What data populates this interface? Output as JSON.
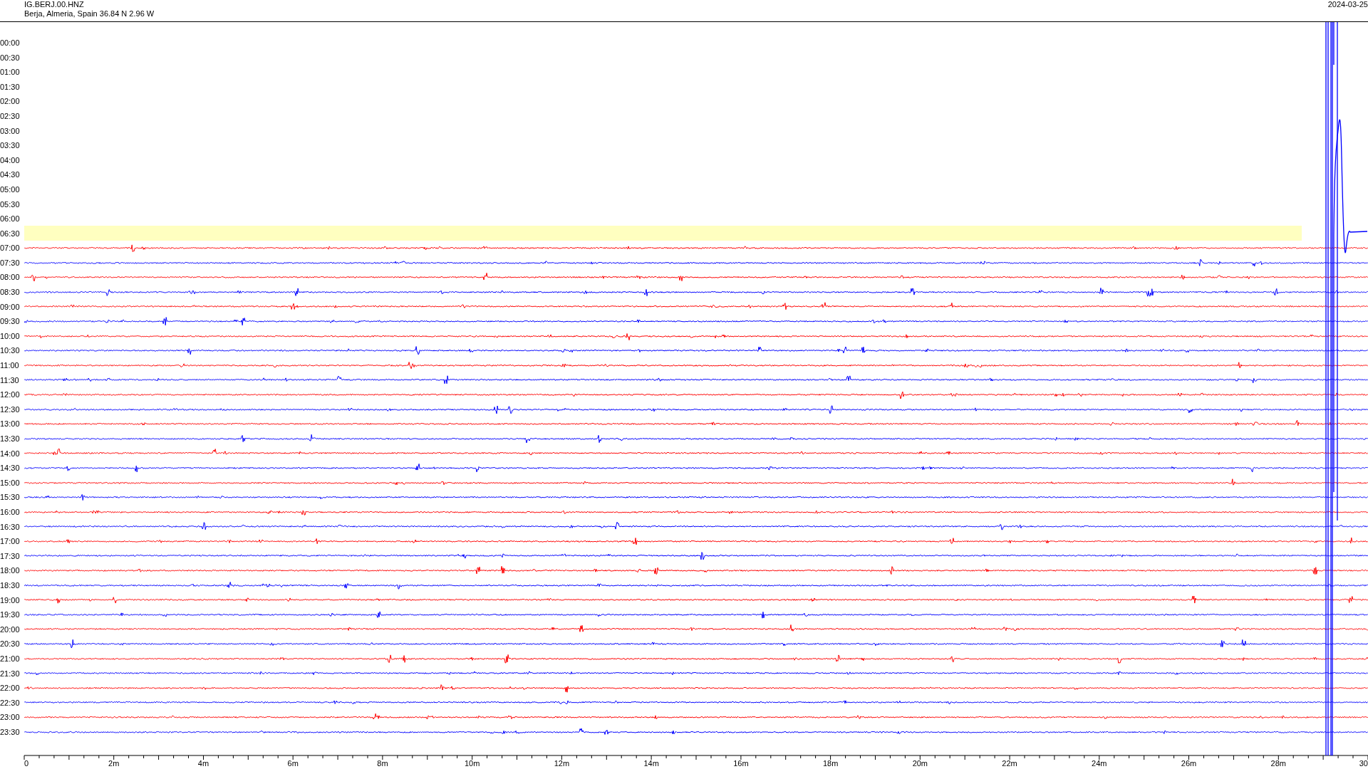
{
  "header": {
    "station": "IG.BERJ.00.HNZ",
    "location": "Berja, Almeria, Spain  36.84 N 2.96 W",
    "date": "2024-03-25"
  },
  "rows": [
    {
      "label": "00:00",
      "kind": "empty",
      "highlighted": false
    },
    {
      "label": "00:30",
      "kind": "empty",
      "highlighted": false
    },
    {
      "label": "01:00",
      "kind": "empty",
      "highlighted": false
    },
    {
      "label": "01:30",
      "kind": "empty",
      "highlighted": false
    },
    {
      "label": "02:00",
      "kind": "empty",
      "highlighted": false
    },
    {
      "label": "02:30",
      "kind": "empty",
      "highlighted": false
    },
    {
      "label": "03:00",
      "kind": "empty",
      "highlighted": false
    },
    {
      "label": "03:30",
      "kind": "empty",
      "highlighted": false
    },
    {
      "label": "04:00",
      "kind": "empty",
      "highlighted": false
    },
    {
      "label": "04:30",
      "kind": "empty",
      "highlighted": false
    },
    {
      "label": "05:00",
      "kind": "empty",
      "highlighted": false
    },
    {
      "label": "05:30",
      "kind": "empty",
      "highlighted": false
    },
    {
      "label": "06:00",
      "kind": "empty",
      "highlighted": false
    },
    {
      "label": "06:30",
      "kind": "empty",
      "highlighted": true
    },
    {
      "label": "07:00",
      "kind": "trace",
      "color": "#ff0000",
      "highlighted": false
    },
    {
      "label": "07:30",
      "kind": "trace",
      "color": "#0000ff",
      "highlighted": false
    },
    {
      "label": "08:00",
      "kind": "trace",
      "color": "#ff0000",
      "highlighted": false
    },
    {
      "label": "08:30",
      "kind": "trace",
      "color": "#0000ff",
      "highlighted": false
    },
    {
      "label": "09:00",
      "kind": "trace",
      "color": "#ff0000",
      "highlighted": false
    },
    {
      "label": "09:30",
      "kind": "trace",
      "color": "#0000ff",
      "highlighted": false
    },
    {
      "label": "10:00",
      "kind": "trace",
      "color": "#ff0000",
      "highlighted": false
    },
    {
      "label": "10:30",
      "kind": "trace",
      "color": "#0000ff",
      "highlighted": false
    },
    {
      "label": "11:00",
      "kind": "trace",
      "color": "#ff0000",
      "highlighted": false
    },
    {
      "label": "11:30",
      "kind": "trace",
      "color": "#0000ff",
      "highlighted": false
    },
    {
      "label": "12:00",
      "kind": "trace",
      "color": "#ff0000",
      "highlighted": false
    },
    {
      "label": "12:30",
      "kind": "trace",
      "color": "#0000ff",
      "highlighted": false
    },
    {
      "label": "13:00",
      "kind": "trace",
      "color": "#ff0000",
      "highlighted": false
    },
    {
      "label": "13:30",
      "kind": "trace",
      "color": "#0000ff",
      "highlighted": false
    },
    {
      "label": "14:00",
      "kind": "trace",
      "color": "#ff0000",
      "highlighted": false
    },
    {
      "label": "14:30",
      "kind": "trace",
      "color": "#0000ff",
      "highlighted": false
    },
    {
      "label": "15:00",
      "kind": "trace",
      "color": "#ff0000",
      "highlighted": false
    },
    {
      "label": "15:30",
      "kind": "trace",
      "color": "#0000ff",
      "highlighted": false
    },
    {
      "label": "16:00",
      "kind": "trace",
      "color": "#ff0000",
      "highlighted": false
    },
    {
      "label": "16:30",
      "kind": "trace",
      "color": "#0000ff",
      "highlighted": false
    },
    {
      "label": "17:00",
      "kind": "trace",
      "color": "#ff0000",
      "highlighted": false
    },
    {
      "label": "17:30",
      "kind": "trace",
      "color": "#0000ff",
      "highlighted": false
    },
    {
      "label": "18:00",
      "kind": "trace",
      "color": "#ff0000",
      "highlighted": false
    },
    {
      "label": "18:30",
      "kind": "trace",
      "color": "#0000ff",
      "highlighted": false
    },
    {
      "label": "19:00",
      "kind": "trace",
      "color": "#ff0000",
      "highlighted": false
    },
    {
      "label": "19:30",
      "kind": "trace",
      "color": "#0000ff",
      "highlighted": false
    },
    {
      "label": "20:00",
      "kind": "trace",
      "color": "#ff0000",
      "highlighted": false
    },
    {
      "label": "20:30",
      "kind": "trace",
      "color": "#0000ff",
      "highlighted": false
    },
    {
      "label": "21:00",
      "kind": "trace",
      "color": "#ff0000",
      "highlighted": false
    },
    {
      "label": "21:30",
      "kind": "trace",
      "color": "#0000ff",
      "highlighted": false
    },
    {
      "label": "22:00",
      "kind": "trace",
      "color": "#ff0000",
      "highlighted": false
    },
    {
      "label": "22:30",
      "kind": "trace",
      "color": "#0000ff",
      "highlighted": false
    },
    {
      "label": "23:00",
      "kind": "trace",
      "color": "#ff0000",
      "highlighted": false
    },
    {
      "label": "23:30",
      "kind": "trace",
      "color": "#0000ff",
      "highlighted": false
    }
  ],
  "x_axis": {
    "labels": [
      "0",
      "2m",
      "4m",
      "6m",
      "8m",
      "10m",
      "12m",
      "14m",
      "16m",
      "18m",
      "20m",
      "22m",
      "24m",
      "26m",
      "28m",
      "30"
    ]
  }
}
